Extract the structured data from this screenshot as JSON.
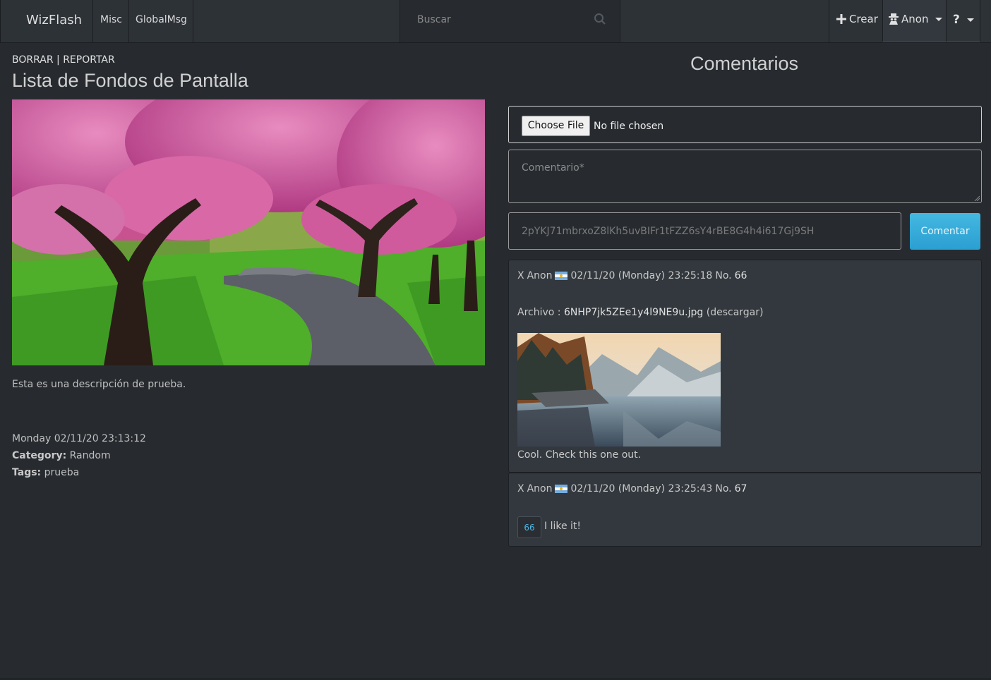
{
  "navbar": {
    "brand": "WizFlash",
    "links": [
      "Misc",
      "GlobalMsg"
    ],
    "search_placeholder": "Buscar",
    "crear_label": "Crear",
    "user_label": "Anon",
    "help_label": "?"
  },
  "post": {
    "actions_borrar": "BORRAR",
    "actions_sep": " | ",
    "actions_reportar": "REPORTAR",
    "title": "Lista de Fondos de Pantalla",
    "description": "Esta es una descripción de prueba.",
    "date": "Monday 02/11/20 23:13:12",
    "category_label": "Category:",
    "category_value": "Random",
    "tags_label": "Tags:",
    "tags_value": "prueba"
  },
  "comments": {
    "title": "Comentarios",
    "choose_file_label": "Choose File",
    "no_file_label": "No file chosen",
    "comment_placeholder": "Comentario*",
    "token_value": "2pYKJ71mbrxoZ8lKh5uvBIFr1tFZZ6sY4rBE8G4h4i617Gj9SH",
    "submit_label": "Comentar",
    "items": [
      {
        "hide": "X",
        "author": "Anon",
        "datetime": "02/11/20 (Monday) 23:25:18",
        "no_label": "No.",
        "number": "66",
        "archivo_label": "Archivo :",
        "filename": "6NHP7jk5ZEe1y4l9NE9u.jpg",
        "download": "(descargar)",
        "text": "Cool. Check this one out."
      },
      {
        "hide": "X",
        "author": "Anon",
        "datetime": "02/11/20 (Monday) 23:25:43",
        "no_label": "No.",
        "number": "67",
        "reply_ref": "66",
        "text": "I like it!"
      }
    ]
  },
  "colors": {
    "background": "#272b30",
    "navbar": "#2d3237",
    "accent_button": "#2a9fd2",
    "card": "#32383e"
  }
}
